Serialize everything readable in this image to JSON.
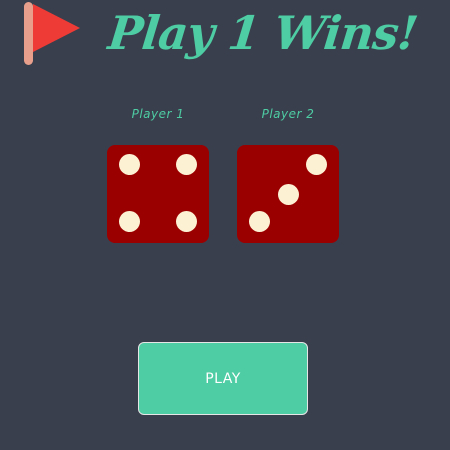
{
  "header": {
    "title": "Play 1 Wins!",
    "icon": "red-flag-icon"
  },
  "players": [
    {
      "label": "Player 1",
      "die_value": 4
    },
    {
      "label": "Player 2",
      "die_value": 3
    }
  ],
  "controls": {
    "play_label": "PLAY"
  },
  "colors": {
    "background": "#393f4d",
    "accent": "#4ecca3",
    "die": "#9b0000",
    "pip": "#fdf1d4",
    "flag": "#ef3b36"
  }
}
